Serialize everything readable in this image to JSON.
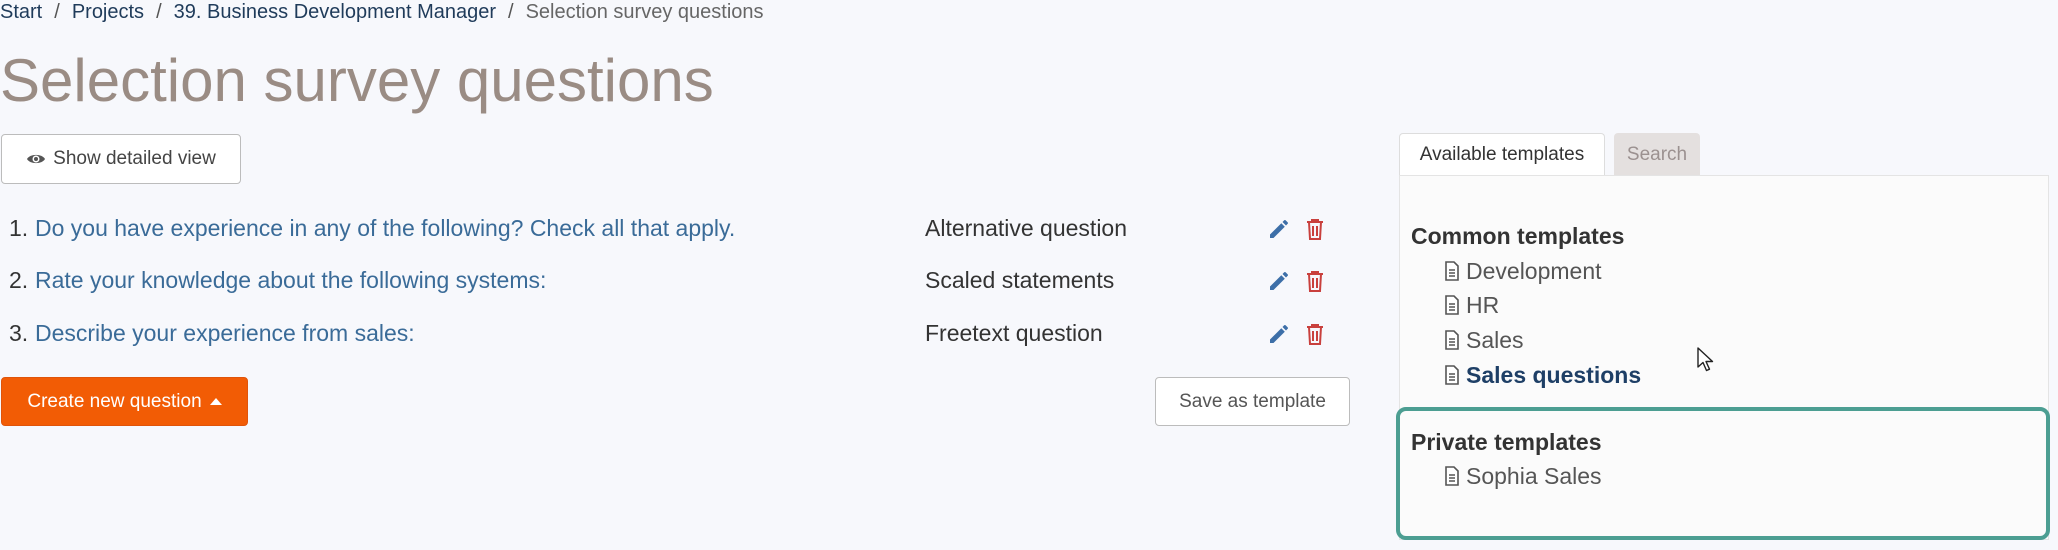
{
  "breadcrumb": {
    "items": [
      "Start",
      "Projects",
      "39. Business Development Manager"
    ],
    "separator": "/",
    "current": "Selection survey questions"
  },
  "page": {
    "title": "Selection survey questions"
  },
  "toolbar": {
    "show_detailed_label": "Show detailed view",
    "create_label": "Create new question",
    "save_template_label": "Save as template"
  },
  "questions": [
    {
      "num": "1.",
      "text": "Do you have experience in any of the following? Check all that apply.",
      "type": "Alternative question"
    },
    {
      "num": "2.",
      "text": "Rate your knowledge about the following systems:",
      "type": "Scaled statements"
    },
    {
      "num": "3.",
      "text": "Describe your experience from sales:",
      "type": "Freetext question"
    }
  ],
  "tabs": {
    "available": "Available templates",
    "search": "Search"
  },
  "templates": {
    "common_title": "Common templates",
    "common": [
      "Development",
      "HR",
      "Sales",
      "Sales questions"
    ],
    "private_title": "Private templates",
    "private": [
      "Sophia Sales"
    ]
  },
  "icons": {
    "eye": "eye-icon",
    "edit": "pencil-icon",
    "delete": "trash-icon",
    "document": "document-icon",
    "caret": "caret-up-icon"
  },
  "colors": {
    "accent_orange": "#f25c05",
    "link_blue": "#3a6b98",
    "edit_blue": "#3d6fa8",
    "delete_red": "#c9403d",
    "highlight_teal": "#4c9e92",
    "title_gray": "#9a8c84"
  }
}
